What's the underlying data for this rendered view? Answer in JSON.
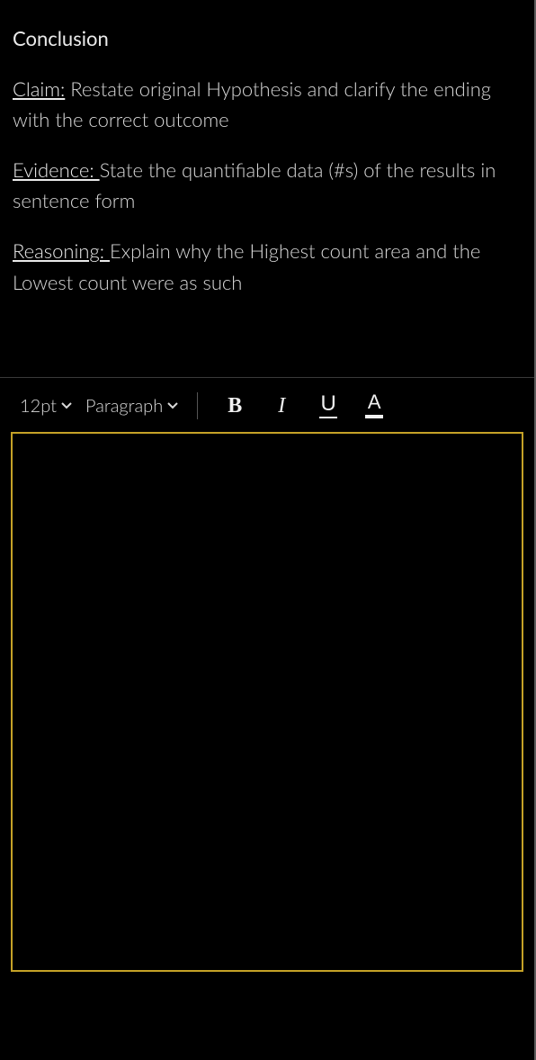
{
  "prompt": {
    "title": "Conclusion",
    "items": [
      {
        "label": "Claim:",
        "text": " Restate original Hypothesis and clarify the ending with the correct outcome"
      },
      {
        "label": "Evidence: ",
        "text": "State the quantifiable data (#s) of the results in sentence form"
      },
      {
        "label": "Reasoning: ",
        "text": "Explain why the Highest count area and the Lowest count were as such"
      }
    ]
  },
  "toolbar": {
    "font_size": "12pt",
    "block_format": "Paragraph",
    "bold_glyph": "B",
    "italic_glyph": "I",
    "underline_glyph": "U",
    "textcolor_glyph": "A"
  },
  "editor": {
    "content": ""
  },
  "colors": {
    "focus_border": "#c5a227"
  }
}
